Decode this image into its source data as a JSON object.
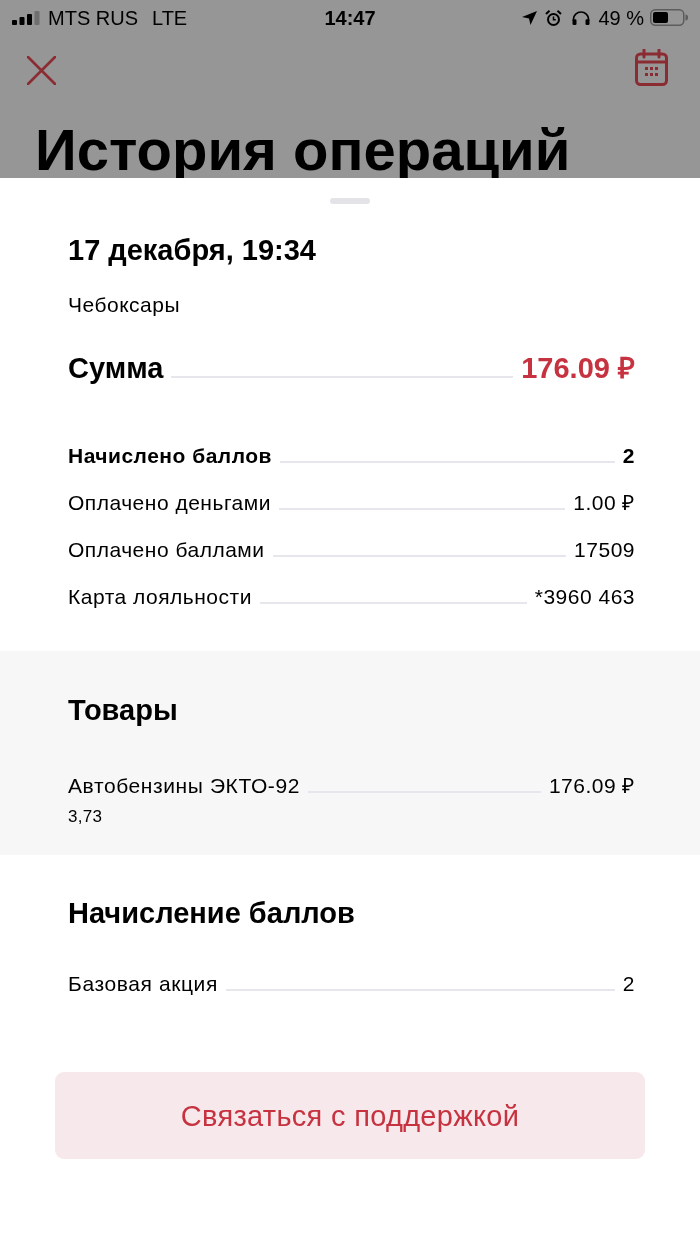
{
  "status_bar": {
    "carrier": "MTS RUS",
    "network": "LTE",
    "time": "14:47",
    "battery": "49 %"
  },
  "header": {
    "title": "История операций"
  },
  "operation": {
    "date": "17 декабря, 19:34",
    "city": "Чебоксары",
    "total": {
      "label": "Сумма",
      "value": "176.09 ₽"
    },
    "details": [
      {
        "label": "Начислено баллов",
        "value": "2",
        "emphasized": true
      },
      {
        "label": "Оплачено деньгами",
        "value": "1.00 ₽",
        "emphasized": false
      },
      {
        "label": "Оплачено баллами",
        "value": "17509",
        "emphasized": false
      },
      {
        "label": "Карта лояльности",
        "value": "*3960 463",
        "emphasized": false
      }
    ]
  },
  "products": {
    "title": "Товары",
    "items": [
      {
        "name": "Автобензины ЭКТО-92",
        "price": "176.09 ₽",
        "quantity": "3,73"
      }
    ]
  },
  "bonuses": {
    "title": "Начисление баллов",
    "items": [
      {
        "label": "Базовая акция",
        "value": "2"
      }
    ]
  },
  "support_button": {
    "label": "Связаться с поддержкой"
  }
}
